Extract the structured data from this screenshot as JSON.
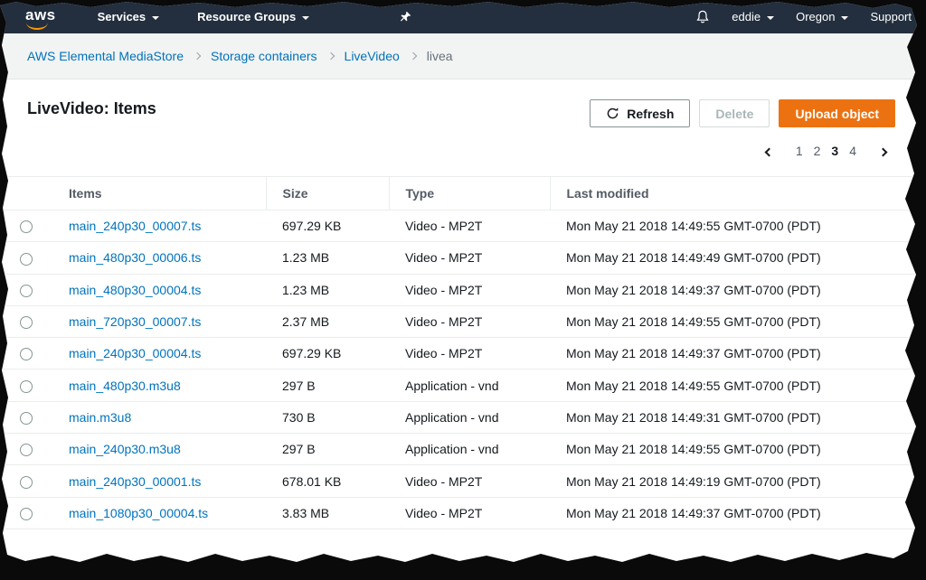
{
  "navbar": {
    "logo": "aws",
    "services": "Services",
    "resource_groups": "Resource Groups",
    "user": "eddie",
    "region": "Oregon",
    "support": "Support"
  },
  "breadcrumb": {
    "items": [
      {
        "label": "AWS Elemental MediaStore"
      },
      {
        "label": "Storage containers"
      },
      {
        "label": "LiveVideo"
      },
      {
        "label": "livea"
      }
    ]
  },
  "header": {
    "title": "LiveVideo: Items",
    "refresh_label": "Refresh",
    "delete_label": "Delete",
    "upload_label": "Upload object"
  },
  "pagination": {
    "pages": [
      "1",
      "2",
      "3",
      "4"
    ],
    "current": "3"
  },
  "table": {
    "columns": [
      "Items",
      "Size",
      "Type",
      "Last modified"
    ],
    "rows": [
      {
        "name": "main_240p30_00007.ts",
        "size": "697.29 KB",
        "type": "Video - MP2T",
        "modified": "Mon May 21 2018 14:49:55 GMT-0700 (PDT)"
      },
      {
        "name": "main_480p30_00006.ts",
        "size": "1.23 MB",
        "type": "Video - MP2T",
        "modified": "Mon May 21 2018 14:49:49 GMT-0700 (PDT)"
      },
      {
        "name": "main_480p30_00004.ts",
        "size": "1.23 MB",
        "type": "Video - MP2T",
        "modified": "Mon May 21 2018 14:49:37 GMT-0700 (PDT)"
      },
      {
        "name": "main_720p30_00007.ts",
        "size": "2.37 MB",
        "type": "Video - MP2T",
        "modified": "Mon May 21 2018 14:49:55 GMT-0700 (PDT)"
      },
      {
        "name": "main_240p30_00004.ts",
        "size": "697.29 KB",
        "type": "Video - MP2T",
        "modified": "Mon May 21 2018 14:49:37 GMT-0700 (PDT)"
      },
      {
        "name": "main_480p30.m3u8",
        "size": "297 B",
        "type": "Application - vnd",
        "modified": "Mon May 21 2018 14:49:55 GMT-0700 (PDT)"
      },
      {
        "name": "main.m3u8",
        "size": "730 B",
        "type": "Application - vnd",
        "modified": "Mon May 21 2018 14:49:31 GMT-0700 (PDT)"
      },
      {
        "name": "main_240p30.m3u8",
        "size": "297 B",
        "type": "Application - vnd",
        "modified": "Mon May 21 2018 14:49:55 GMT-0700 (PDT)"
      },
      {
        "name": "main_240p30_00001.ts",
        "size": "678.01 KB",
        "type": "Video - MP2T",
        "modified": "Mon May 21 2018 14:49:19 GMT-0700 (PDT)"
      },
      {
        "name": "main_1080p30_00004.ts",
        "size": "3.83 MB",
        "type": "Video - MP2T",
        "modified": "Mon May 21 2018 14:49:37 GMT-0700 (PDT)"
      }
    ]
  },
  "colors": {
    "navbar_bg": "#232f3e",
    "accent_orange": "#ec7211",
    "logo_smile": "#ff9900",
    "link_blue": "#0073bb"
  }
}
